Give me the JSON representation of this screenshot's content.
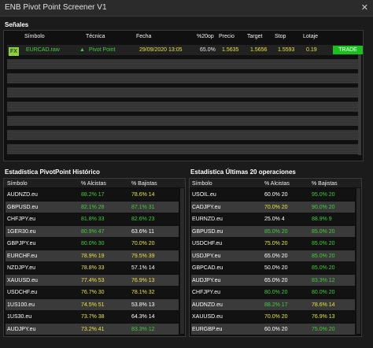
{
  "window": {
    "title": "ENB Pivot Point Screener V1",
    "close_glyph": "✕"
  },
  "signals": {
    "label": "Señales",
    "columns": [
      "Símbolo",
      "Técnica",
      "Fecha",
      "%20op",
      "Precio",
      "Target",
      "Stop",
      "Lotaje"
    ],
    "active": {
      "badge": "FX",
      "symbol": "EURCAD.raw",
      "arrow": "▲",
      "technique": "Pivot Point",
      "date": "29/09/2020 13:05",
      "pct": "65.0%",
      "price": "1.5635",
      "target": "1.5656",
      "stop": "1.5593",
      "lot": "0.19",
      "button": "TRADE"
    }
  },
  "hist": {
    "label": "Estadística PivotPoint Histórico",
    "columns": [
      "Símbolo",
      "% Alcistas",
      "% Bajistas"
    ],
    "rows": [
      {
        "symbol": "AUDNZD.eu",
        "up": "88.2% 17",
        "down": "78.6% 14",
        "up_color": "green",
        "down_color": "yellow"
      },
      {
        "symbol": "GBPUSD.eu",
        "up": "82.1% 28",
        "down": "87.1% 31",
        "up_color": "green",
        "down_color": "green"
      },
      {
        "symbol": "CHFJPY.eu",
        "up": "81.8% 33",
        "down": "82.6% 23",
        "up_color": "green",
        "down_color": "green"
      },
      {
        "symbol": "1GER30.eu",
        "up": "80.9% 47",
        "down": "63.6% 11",
        "up_color": "green",
        "down_color": "white"
      },
      {
        "symbol": "GBPJPY.eu",
        "up": "80.0% 30",
        "down": "70.0% 20",
        "up_color": "green",
        "down_color": "yellow"
      },
      {
        "symbol": "EURCHF.eu",
        "up": "78.9% 19",
        "down": "79.5% 39",
        "up_color": "yellow",
        "down_color": "yellow"
      },
      {
        "symbol": "NZDJPY.eu",
        "up": "78.8% 33",
        "down": "57.1% 14",
        "up_color": "yellow",
        "down_color": "white"
      },
      {
        "symbol": "XAUUSD.eu",
        "up": "77.4% 53",
        "down": "76.9% 13",
        "up_color": "yellow",
        "down_color": "yellow"
      },
      {
        "symbol": "USDCHF.eu",
        "up": "76.7% 30",
        "down": "78.1% 32",
        "up_color": "yellow",
        "down_color": "yellow"
      },
      {
        "symbol": "1US100.eu",
        "up": "74.5% 51",
        "down": "53.8% 13",
        "up_color": "yellow",
        "down_color": "white"
      },
      {
        "symbol": "1US30.eu",
        "up": "73.7% 38",
        "down": "64.3% 14",
        "up_color": "yellow",
        "down_color": "white"
      },
      {
        "symbol": "AUDJPY.eu",
        "up": "73.2% 41",
        "down": "83.3% 12",
        "up_color": "yellow",
        "down_color": "green"
      }
    ]
  },
  "last20": {
    "label": "Estadística Últimas 20 operaciones",
    "columns": [
      "Símbolo",
      "% Alcistas",
      "% Bajistas"
    ],
    "rows": [
      {
        "symbol": "USOIL.eu",
        "up": "60.0% 20",
        "down": "95.0% 20",
        "up_color": "white",
        "down_color": "green"
      },
      {
        "symbol": "CADJPY.eu",
        "up": "70.0% 20",
        "down": "90.0% 20",
        "up_color": "yellow",
        "down_color": "green"
      },
      {
        "symbol": "EURNZD.eu",
        "up": "25.0% 4",
        "down": "88.9% 9",
        "up_color": "white",
        "down_color": "green"
      },
      {
        "symbol": "GBPUSD.eu",
        "up": "85.0% 20",
        "down": "85.0% 20",
        "up_color": "green",
        "down_color": "green"
      },
      {
        "symbol": "USDCHF.eu",
        "up": "75.0% 20",
        "down": "85.0% 20",
        "up_color": "yellow",
        "down_color": "green"
      },
      {
        "symbol": "USDJPY.eu",
        "up": "65.0% 20",
        "down": "85.0% 20",
        "up_color": "white",
        "down_color": "green"
      },
      {
        "symbol": "GBPCAD.eu",
        "up": "50.0% 20",
        "down": "85.0% 20",
        "up_color": "white",
        "down_color": "green"
      },
      {
        "symbol": "AUDJPY.eu",
        "up": "65.0% 20",
        "down": "83.3% 12",
        "up_color": "white",
        "down_color": "green"
      },
      {
        "symbol": "CHFJPY.eu",
        "up": "80.0% 20",
        "down": "80.0% 20",
        "up_color": "green",
        "down_color": "green"
      },
      {
        "symbol": "AUDNZD.eu",
        "up": "88.2% 17",
        "down": "78.6% 14",
        "up_color": "green",
        "down_color": "yellow"
      },
      {
        "symbol": "XAUUSD.eu",
        "up": "70.0% 20",
        "down": "76.9% 13",
        "up_color": "yellow",
        "down_color": "yellow"
      },
      {
        "symbol": "EURGBP.eu",
        "up": "60.0% 20",
        "down": "75.0% 20",
        "up_color": "white",
        "down_color": "green"
      }
    ]
  },
  "colors": {
    "green": "#3fcf3a",
    "yellow": "#e6e43a",
    "white": "#ffffff",
    "trade": "#19c11e",
    "badge": "#8bd13f"
  }
}
